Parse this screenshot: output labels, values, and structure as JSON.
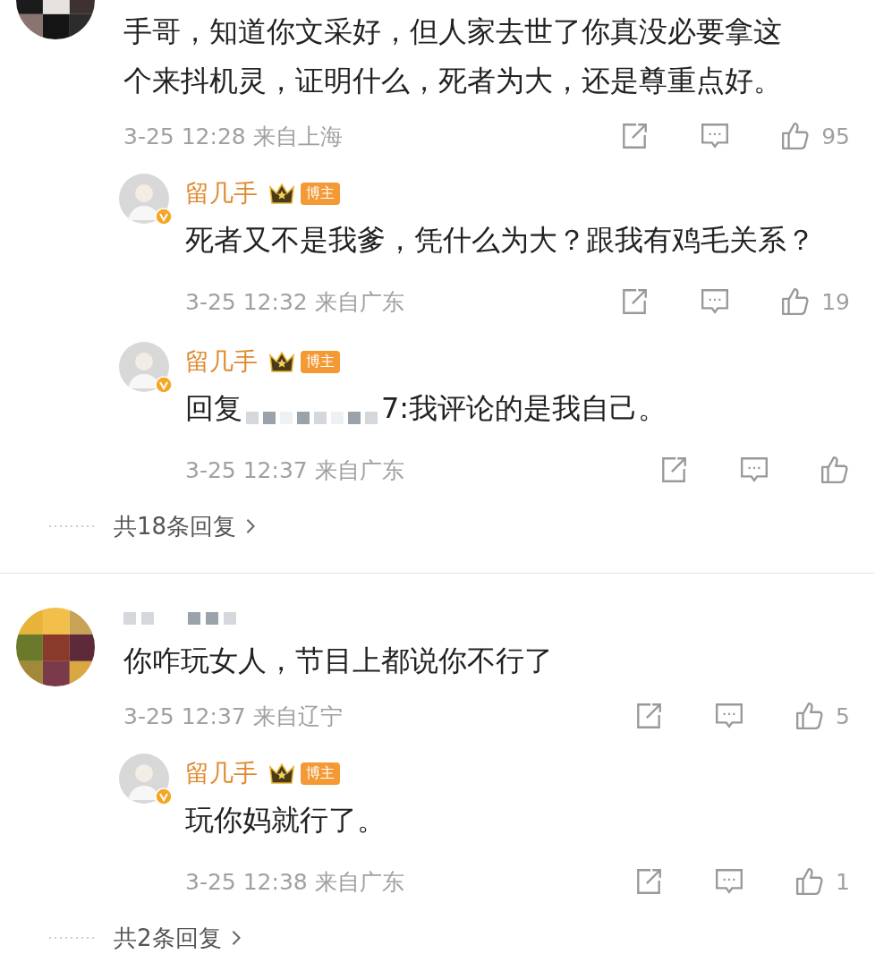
{
  "threads": [
    {
      "avatar": {
        "kind": "pixelated"
      },
      "name_masked": false,
      "text": "手哥，知道你文采好，但人家去世了你真没必要拿这个来抖机灵，证明什么，死者为大，还是尊重点好。",
      "time": "3-25 12:28",
      "location": "来自上海",
      "likes": "95",
      "replies": [
        {
          "avatar": {
            "kind": "cartoon",
            "verified": true
          },
          "name": "留几手",
          "badge": "博主",
          "text": "死者又不是我爹，凭什么为大？跟我有鸡毛关系？",
          "time": "3-25 12:32",
          "location": "来自广东",
          "likes": "19"
        },
        {
          "avatar": {
            "kind": "cartoon",
            "verified": true
          },
          "name": "留几手",
          "badge": "博主",
          "reply_prefix": "回复",
          "reply_masked": true,
          "text": "7:我评论的是我自己。",
          "time": "3-25 12:37",
          "location": "来自广东"
        }
      ],
      "more_replies": "共18条回复"
    },
    {
      "avatar": {
        "kind": "pixelated"
      },
      "name_masked": true,
      "text": "你咋玩女人，节目上都说你不行了",
      "time": "3-25 12:37",
      "location": "来自辽宁",
      "likes": "5",
      "replies": [
        {
          "avatar": {
            "kind": "cartoon",
            "verified": true
          },
          "name": "留几手",
          "badge": "博主",
          "text": "玩你妈就行了。",
          "time": "3-25 12:38",
          "location": "来自广东",
          "likes": "1"
        }
      ],
      "more_replies": "共2条回复"
    }
  ]
}
